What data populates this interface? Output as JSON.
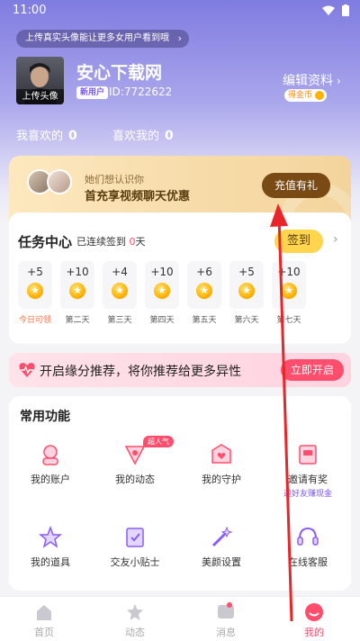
{
  "status_bar": {
    "time": "11:00"
  },
  "notice": {
    "text": "上传真实头像能让更多女用户看到哦"
  },
  "profile": {
    "avatar_label": "上传头像",
    "name": "安心下载网",
    "new_badge": "新用户",
    "id_text": "ID:7722622",
    "edit_label": "编辑资料",
    "coin_badge": "得金币"
  },
  "stats": {
    "i_like_label": "我喜欢的",
    "i_like_count": "0",
    "likes_me_label": "喜欢我的",
    "likes_me_count": "0"
  },
  "vip": {
    "subtitle": "她们想认识你",
    "title": "首充享视频聊天优惠",
    "button": "充值有礼"
  },
  "tasks": {
    "title": "任务中心",
    "streak_prefix": "已连续签到",
    "streak_days": "0",
    "streak_suffix": "天",
    "signin_button": "签到",
    "days": [
      {
        "points": "+5",
        "label": "今日可领"
      },
      {
        "points": "+10",
        "label": "第二天"
      },
      {
        "points": "+4",
        "label": "第三天"
      },
      {
        "points": "+10",
        "label": "第四天"
      },
      {
        "points": "+6",
        "label": "第五天"
      },
      {
        "points": "+5",
        "label": "第六天"
      },
      {
        "points": "+10",
        "label": "第七天"
      }
    ]
  },
  "match": {
    "text": "开启缘分推荐，将你推荐给更多异性",
    "button": "立即开启"
  },
  "functions": {
    "title": "常用功能",
    "hot_badge": "超人气",
    "items": [
      {
        "label": "我的账户",
        "icon": "account-icon"
      },
      {
        "label": "我的动态",
        "icon": "moments-icon"
      },
      {
        "label": "我的守护",
        "icon": "guard-icon"
      },
      {
        "label": "邀请有奖",
        "sub": "邀好友赚现金",
        "icon": "invite-icon"
      },
      {
        "label": "我的道具",
        "icon": "props-icon"
      },
      {
        "label": "交友小贴士",
        "icon": "tips-icon"
      },
      {
        "label": "美颜设置",
        "icon": "beauty-icon"
      },
      {
        "label": "在线客服",
        "icon": "service-icon"
      }
    ]
  },
  "tabbar": {
    "items": [
      {
        "label": "首页",
        "icon": "home-icon"
      },
      {
        "label": "动态",
        "icon": "star-icon"
      },
      {
        "label": "消息",
        "icon": "message-icon"
      },
      {
        "label": "我的",
        "icon": "profile-icon"
      }
    ],
    "active": "我的"
  },
  "colors": {
    "accent": "#7f7ce0",
    "pink": "#ff4d6d",
    "gold": "#ffb300",
    "annotation_arrow": "#e8262a"
  }
}
